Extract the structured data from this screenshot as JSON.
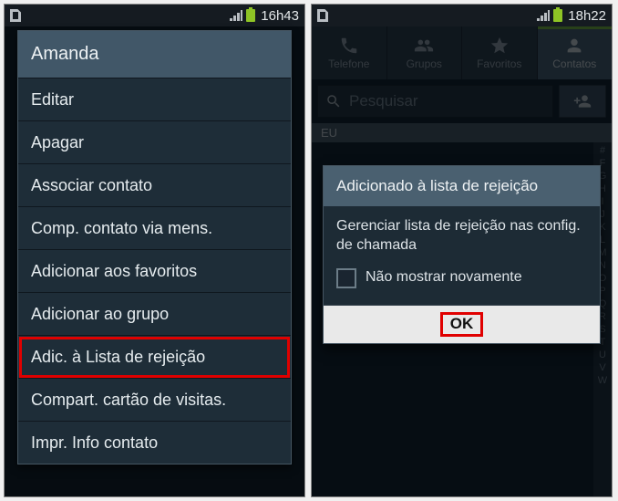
{
  "left": {
    "status": {
      "time": "16h43"
    },
    "menu_title": "Amanda",
    "menu_items": [
      "Editar",
      "Apagar",
      "Associar contato",
      "Comp. contato via mens.",
      "Adicionar aos favoritos",
      "Adicionar ao grupo",
      "Adic. à Lista de rejeição",
      "Compart. cartão de visitas.",
      "Impr. Info contato"
    ],
    "highlight_index": 6
  },
  "right": {
    "status": {
      "time": "18h22"
    },
    "tabs": [
      {
        "icon": "phone-icon",
        "label": "Telefone"
      },
      {
        "icon": "group-icon",
        "label": "Grupos"
      },
      {
        "icon": "star-icon",
        "label": "Favoritos"
      },
      {
        "icon": "person-icon",
        "label": "Contatos"
      }
    ],
    "active_tab": 3,
    "search_placeholder": "Pesquisar",
    "section": "EU",
    "index_rail": [
      "#",
      "F",
      "G",
      "H",
      "I",
      "J",
      "K",
      "L",
      "M",
      "N",
      "O",
      "P",
      "Q",
      "R",
      "S",
      "T",
      "U",
      "V",
      "W"
    ],
    "dialog": {
      "title": "Adicionado à lista de rejeição",
      "body": "Gerenciar lista de rejeição nas config. de chamada",
      "checkbox_label": "Não mostrar novamente",
      "ok_label": "OK"
    }
  }
}
